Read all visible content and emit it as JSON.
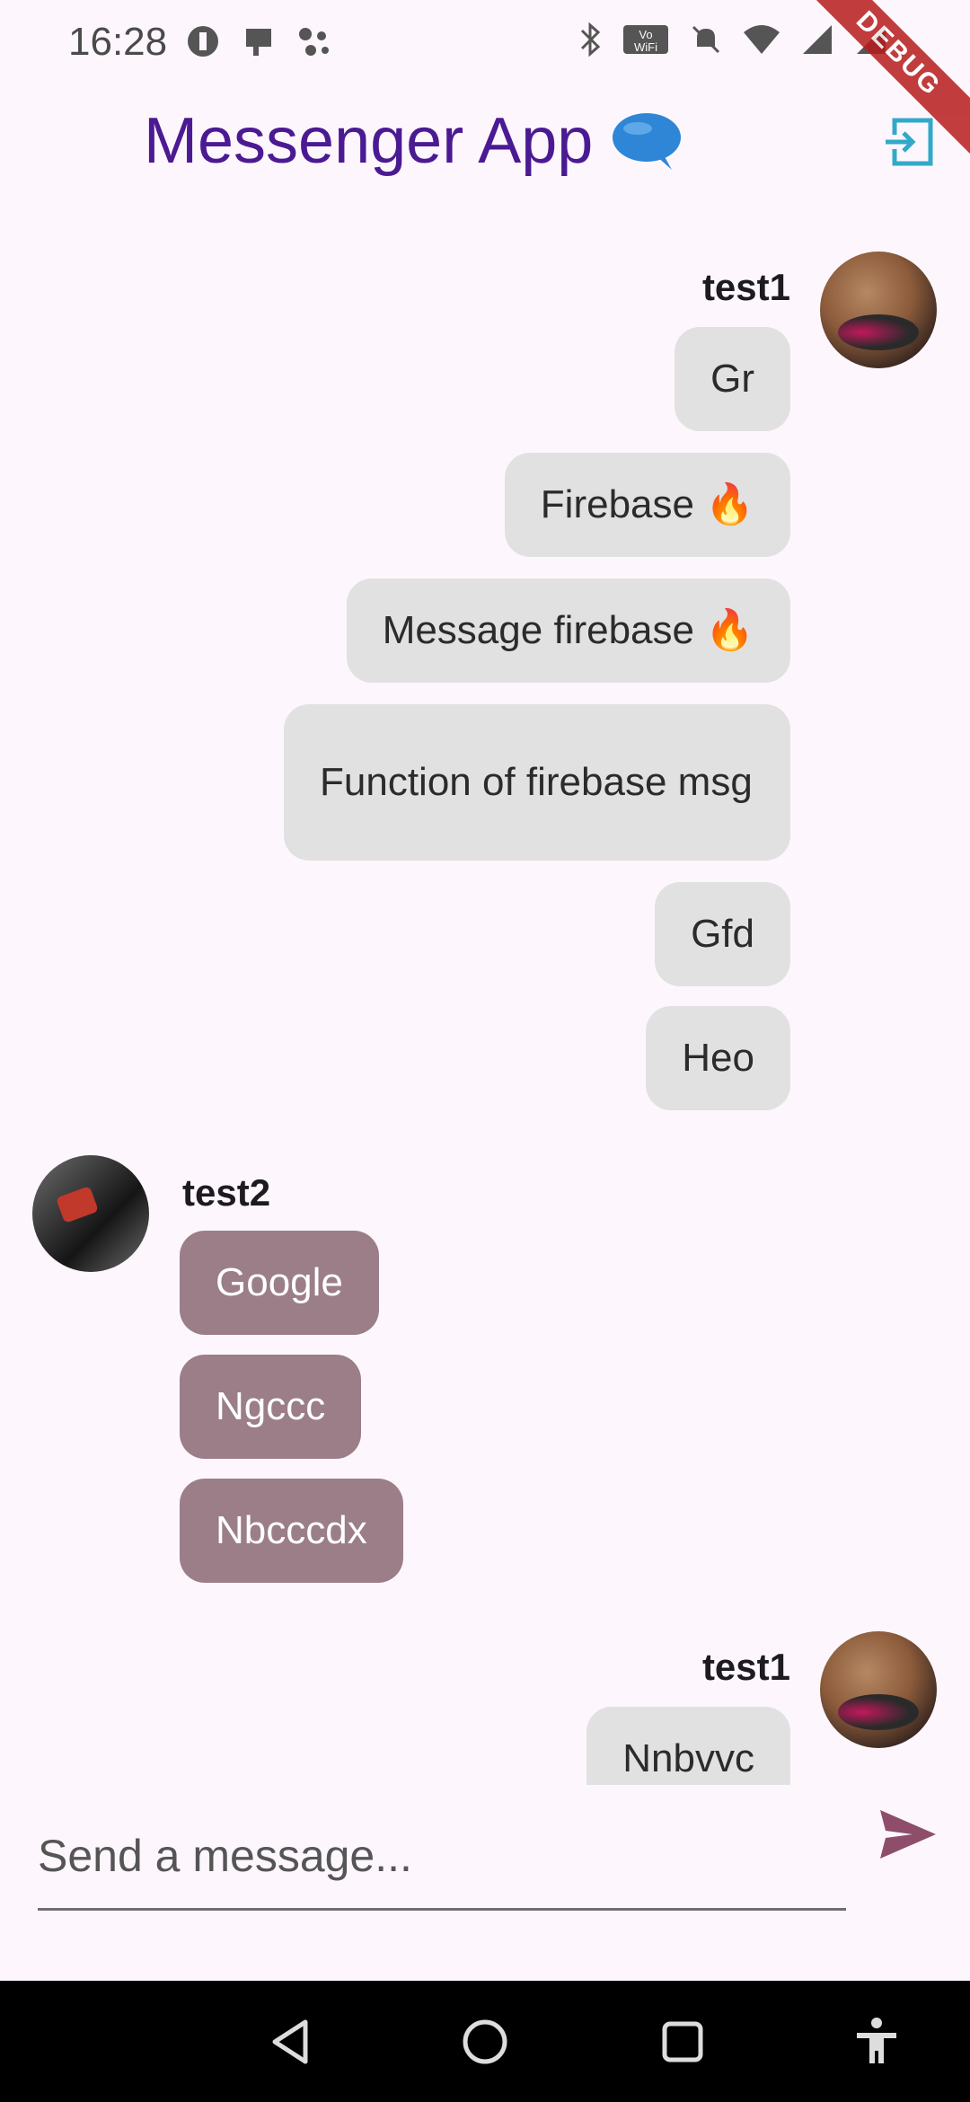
{
  "status_bar": {
    "time": "16:28",
    "ribbon": "DEBUG"
  },
  "app_bar": {
    "title": "Messenger App",
    "title_emoji": "🗨️"
  },
  "messages": [
    {
      "sender": "test1",
      "side": "right",
      "texts": [
        "Gr",
        "Firebase 🔥",
        "Message firebase 🔥",
        "Function of firebase msg",
        "Gfd",
        "Heo"
      ]
    },
    {
      "sender": "test2",
      "side": "left",
      "texts": [
        "Google",
        "Ngccc",
        "Nbcccdx"
      ]
    },
    {
      "sender": "test1",
      "side": "right",
      "texts": [
        "Nnbvvc"
      ]
    }
  ],
  "composer": {
    "placeholder": "Send a message..."
  },
  "colors": {
    "accent": "#4b1a93",
    "my_bubble": "#e1e1e1",
    "their_bubble": "#9b7e88",
    "send_icon": "#8e4e6b",
    "logout_icon": "#33a9c9"
  }
}
